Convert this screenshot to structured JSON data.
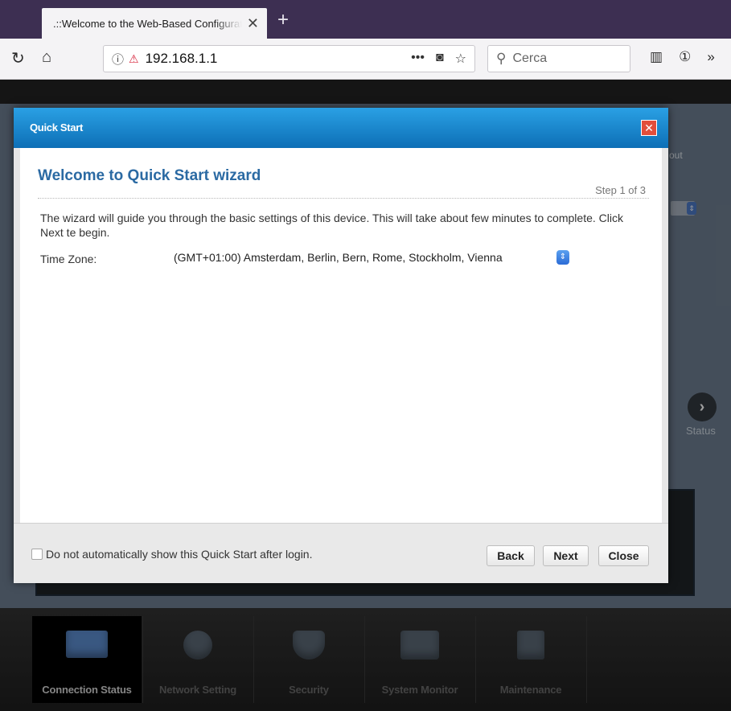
{
  "browser": {
    "tab_title": ".::Welcome to the Web-Based Configurator::.",
    "url": "192.168.1.1",
    "search_placeholder": "Cerca"
  },
  "background": {
    "logout_text": "out",
    "status_text": "Status"
  },
  "modal": {
    "title": "Quick Start",
    "wizard_title": "Welcome to Quick Start wizard",
    "step": "Step 1 of 3",
    "description": "The wizard will guide you through the basic settings of this device. This will take about few minutes to complete. Click Next te begin.",
    "time_zone_label": "Time Zone:",
    "time_zone_value": "(GMT+01:00) Amsterdam, Berlin, Bern, Rome, Stockholm, Vienna",
    "dont_show_label": "Do not automatically show this Quick Start after login.",
    "dont_show_checked": false,
    "buttons": {
      "back": "Back",
      "next": "Next",
      "close": "Close"
    }
  },
  "bottom_menu": [
    {
      "label": "Connection Status",
      "icon": "monitor-icon",
      "active": true
    },
    {
      "label": "Network Setting",
      "icon": "gear-icon",
      "active": false
    },
    {
      "label": "Security",
      "icon": "shield-icon",
      "active": false
    },
    {
      "label": "System Monitor",
      "icon": "chart-monitor-icon",
      "active": false
    },
    {
      "label": "Maintenance",
      "icon": "toolbox-icon",
      "active": false
    }
  ],
  "colors": {
    "modal_header": "#1a86cf",
    "wizard_title": "#2b6aa3",
    "close_button": "#e24e3b"
  }
}
